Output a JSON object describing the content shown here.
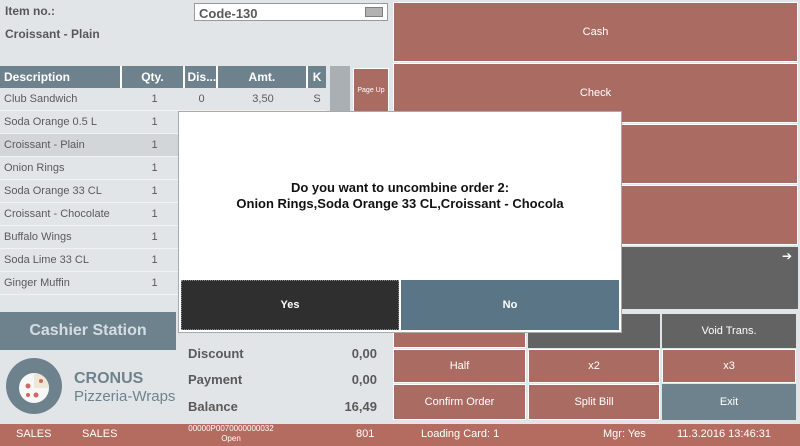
{
  "header": {
    "item_no_label": "Item no.:",
    "item_code": "Code-130",
    "current_item": "Croissant - Plain"
  },
  "grid": {
    "columns": [
      "Description",
      "Qty.",
      "Dis...",
      "Amt.",
      "K"
    ],
    "rows": [
      {
        "desc": "Club Sandwich",
        "qty": "1",
        "dis": "0",
        "amt": "3,50",
        "k": "S"
      },
      {
        "desc": "Soda Orange 0.5 L",
        "qty": "1",
        "dis": "",
        "amt": "",
        "k": ""
      },
      {
        "desc": "Croissant - Plain",
        "qty": "1",
        "dis": "",
        "amt": "",
        "k": ""
      },
      {
        "desc": "Onion Rings",
        "qty": "1",
        "dis": "",
        "amt": "",
        "k": ""
      },
      {
        "desc": "Soda Orange 33 CL",
        "qty": "1",
        "dis": "",
        "amt": "",
        "k": ""
      },
      {
        "desc": "Croissant - Chocolate",
        "qty": "1",
        "dis": "",
        "amt": "",
        "k": ""
      },
      {
        "desc": "Buffalo Wings",
        "qty": "1",
        "dis": "",
        "amt": "",
        "k": ""
      },
      {
        "desc": "Soda Lime 33 CL",
        "qty": "1",
        "dis": "",
        "amt": "",
        "k": ""
      },
      {
        "desc": "Ginger Muffin",
        "qty": "1",
        "dis": "",
        "amt": "",
        "k": ""
      }
    ],
    "page_up": "Page Up"
  },
  "cashier_label": "Cashier Station",
  "logo": {
    "brand": "CRONUS",
    "sub": "Pizzeria-Wraps"
  },
  "totals": {
    "discount_label": "Discount",
    "discount": "0,00",
    "payment_label": "Payment",
    "payment": "0,00",
    "balance_label": "Balance",
    "balance": "16,49"
  },
  "buttons": {
    "cash": "Cash",
    "check": "Check",
    "void_trans": "Void Trans.",
    "half": "Half",
    "x2": "x2",
    "x3": "x3",
    "confirm_order": "Confirm Order",
    "split_bill": "Split Bill",
    "exit": "Exit"
  },
  "dialog": {
    "line1": "Do you want to uncombine order 2:",
    "line2": "Onion Rings,Soda Orange 33 CL,Croissant - Chocola",
    "yes": "Yes",
    "no": "No"
  },
  "status_bar": {
    "mode1": "SALES",
    "mode2": "SALES",
    "receipt_no": "00000P0070000000032",
    "receipt_state": "Open",
    "terminal": "801",
    "loading_card": "Loading Card: 1",
    "mgr": "Mgr: Yes",
    "datetime": "11.3.2016 13:46:31"
  },
  "colors": {
    "accent_red": "#8e3b2e",
    "slate": "#3e5968",
    "dark": "#2f2f2f"
  }
}
